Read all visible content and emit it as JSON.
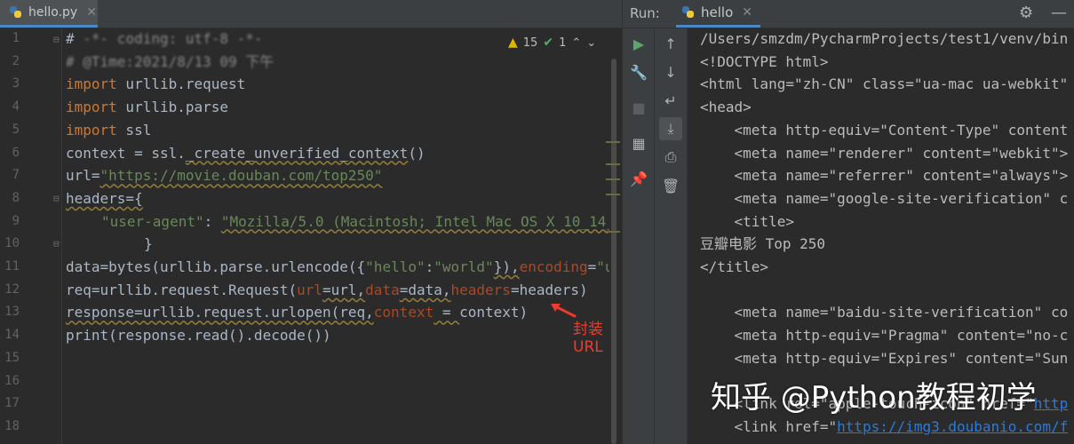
{
  "editor": {
    "tab": {
      "label": "hello.py",
      "close": "✕"
    },
    "inspections": {
      "warnings": "15",
      "ok": "1"
    },
    "line_numbers": [
      "1",
      "2",
      "3",
      "4",
      "5",
      "6",
      "7",
      "8",
      "9",
      "10",
      "11",
      "12",
      "13",
      "14",
      "15",
      "16",
      "17",
      "18"
    ],
    "lines": {
      "l1": {
        "hash": "#",
        "rest": " -*- coding: utf-8 -*-"
      },
      "l2": {
        "text": "# @Time:2021/8/13 09 下午"
      },
      "l3": {
        "kw": "import",
        "rest": " urllib.request"
      },
      "l4": {
        "kw": "import",
        "rest": " urllib.parse"
      },
      "l5": {
        "kw": "import",
        "rest": " ssl"
      },
      "l6": {
        "a": "context = ssl.",
        "b": "_create_unverified_context",
        "c": "()"
      },
      "l7": {
        "a": "url=",
        "s": "\"https://movie.douban.com/top250\""
      },
      "l8": {
        "a": "headers={"
      },
      "l9": {
        "k": "\"user-agent\"",
        "colon": ": ",
        "v": "\"Mozilla/5.0 (Macintosh; Intel Mac OS X 10_14_"
      },
      "l10": {
        "a": "}"
      },
      "l11": {
        "a": "data=",
        "b": "bytes",
        "c": "(urllib.parse.urlencode({",
        "s1": "\"hello\"",
        "d": ":",
        "s2": "\"world\"",
        "e": "}),",
        "p": "encoding",
        "f": "=",
        "s3": "\"u"
      },
      "l12": {
        "a": "req=urllib.request.Request(",
        "p1": "url",
        "b": "=url,",
        "p2": "data",
        "c": "=data,",
        "p3": "headers",
        "d": "=headers)"
      },
      "l13": {
        "a": "response=urllib.request.urlopen(req,",
        "p": "context",
        "b": " = ",
        "c": "context)"
      },
      "l14": {
        "a": "print",
        "b": "(response.read().decode())"
      }
    },
    "annotation": "封装URL"
  },
  "run": {
    "label": "Run:",
    "tab": {
      "label": "hello",
      "close": "✕"
    },
    "output": [
      "/Users/smzdm/PycharmProjects/test1/venv/bin",
      "<!DOCTYPE html>",
      "<html lang=\"zh-CN\" class=\"ua-mac ua-webkit\"",
      "<head>",
      "    <meta http-equiv=\"Content-Type\" content",
      "    <meta name=\"renderer\" content=\"webkit\">",
      "    <meta name=\"referrer\" content=\"always\">",
      "    <meta name=\"google-site-verification\" c",
      "    <title>",
      "豆瓣电影 Top 250",
      "</title>",
      "",
      "    <meta name=\"baidu-site-verification\" co",
      "    <meta http-equiv=\"Pragma\" content=\"no-c",
      "    <meta http-equiv=\"Expires\" content=\"Sun"
    ],
    "link_line_1": {
      "pre": "    <link rel=\"apple-touch-icon\" href=\"",
      "url": "http"
    },
    "link_line_2": {
      "pre": "    <link href=\"",
      "url": "https://img3.doubanio.com/f"
    }
  },
  "watermark": "知乎 @Python教程初学",
  "colors": {
    "background": "#2b2b2b",
    "keyword": "#cc7832",
    "string": "#6a8759",
    "param": "#aa4926",
    "link": "#287bde",
    "annotation": "#ef3b2d"
  }
}
